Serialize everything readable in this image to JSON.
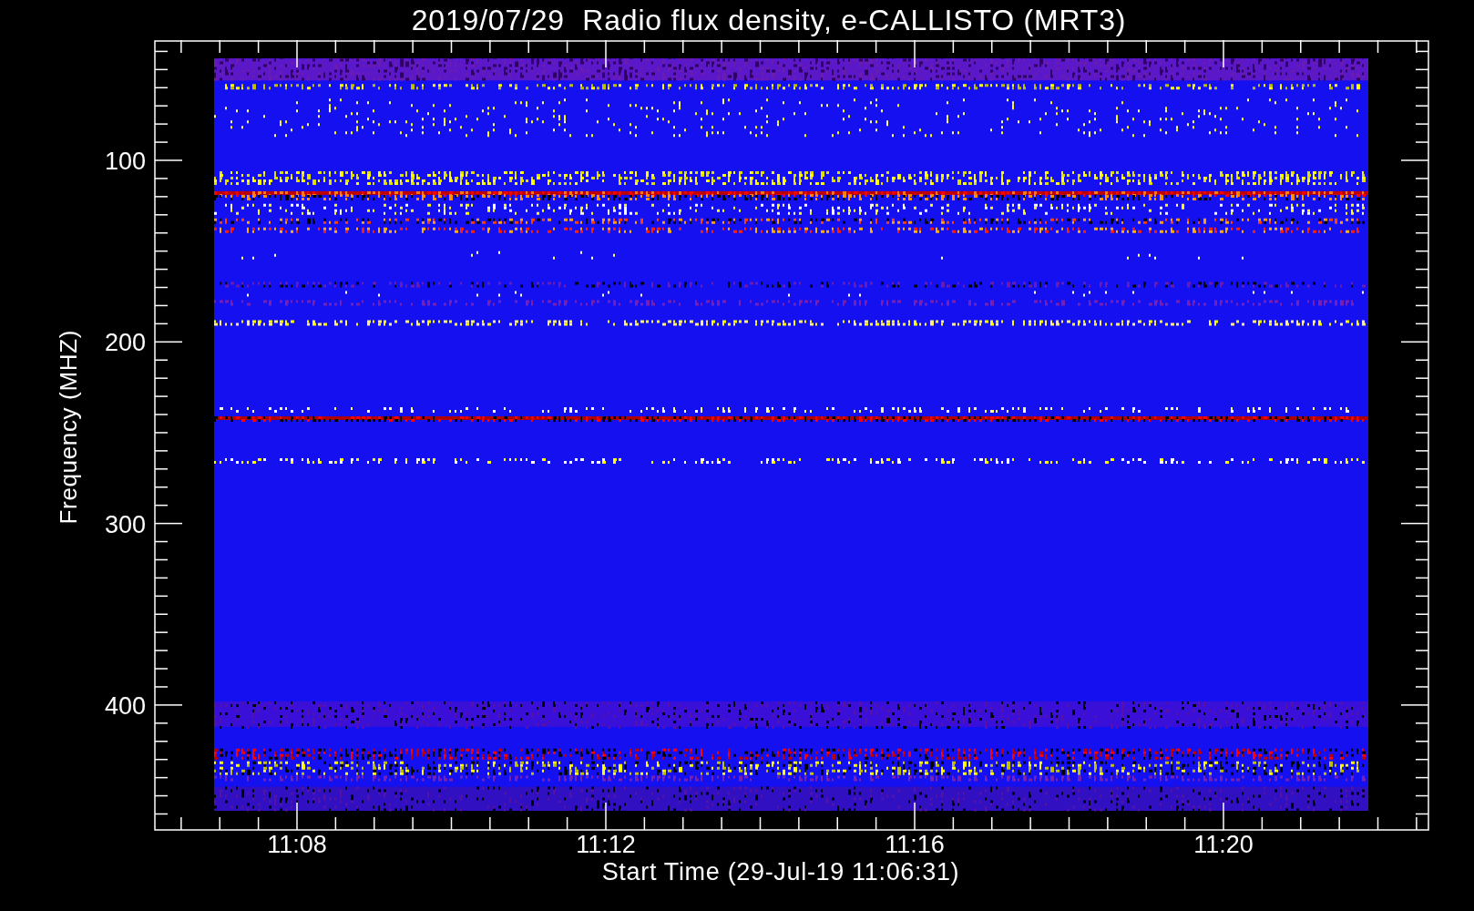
{
  "title": "2019/07/29  Radio flux density, e-CALLISTO (MRT3)",
  "plot": {
    "ylabel": "Frequency (MHZ)",
    "xlabel": "Start Time (29-Jul-19 11:06:31)",
    "yticks": [
      "100",
      "200",
      "300",
      "400"
    ],
    "xticks": [
      "11:08",
      "11:12",
      "11:16",
      "11:20"
    ]
  }
}
